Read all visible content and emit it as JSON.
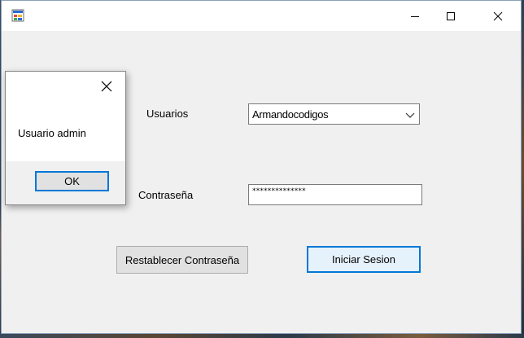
{
  "window": {
    "minimize_icon": "minimize-icon",
    "maximize_icon": "maximize-icon",
    "close_icon": "close-icon",
    "app_icon": "windows-form-icon"
  },
  "form": {
    "usuarios_label": "Usuarios",
    "usuarios_value": "Armandocodigos",
    "password_label": "Contraseña",
    "password_value": "**************",
    "reset_button": "Restablecer Contraseña",
    "login_button": "Iniciar Sesion"
  },
  "messagebox": {
    "text": "Usuario admin",
    "ok_button": "OK"
  },
  "colors": {
    "accent": "#0078d7",
    "window_bg": "#f0f0f0",
    "button_bg": "#e1e1e1"
  }
}
